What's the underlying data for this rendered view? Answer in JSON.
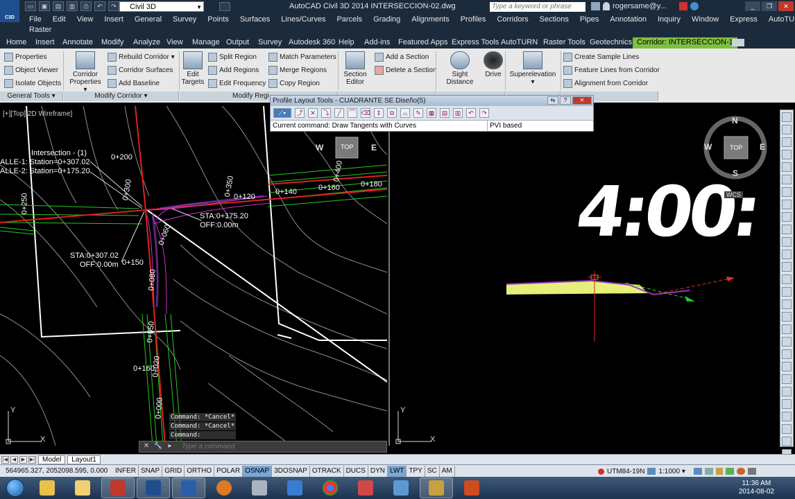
{
  "titlebar": {
    "app_logo": "C3D",
    "workspace": "Civil 3D",
    "title": "AutoCAD Civil 3D 2014    INTERSECCION-02.dwg",
    "search_placeholder": "Type a keyword or phrase",
    "user": "rogersame@y..."
  },
  "menu": {
    "row1": [
      "File",
      "Edit",
      "View",
      "Insert",
      "General",
      "Survey",
      "Points",
      "Surfaces",
      "Lines/Curves",
      "Parcels",
      "Grading",
      "Alignments",
      "Profiles",
      "Corridors",
      "Sections",
      "Pipes",
      "Annotation",
      "Inquiry",
      "Window",
      "Express",
      "AutoTURN"
    ],
    "row2": "Raster"
  },
  "ribbon_tabs": [
    "Home",
    "Insert",
    "Annotate",
    "Modify",
    "Analyze",
    "View",
    "Manage",
    "Output",
    "Survey",
    "Autodesk 360",
    "Help",
    "Add-ins",
    "Featured Apps",
    "Express Tools",
    "AutoTURN",
    "Raster Tools",
    "Geotechnics",
    "Corridor: INTERSECCION-1"
  ],
  "ribbon": {
    "general_tools": {
      "properties": "Properties",
      "object_viewer": "Object Viewer",
      "isolate_objects": "Isolate Objects",
      "panel_label": "General Tools ▾"
    },
    "modify_corridor": {
      "corridor_properties": "Corridor Properties ▾",
      "rebuild_corridor": "Rebuild Corridor ▾",
      "corridor_surfaces": "Corridor Surfaces",
      "add_baseline": "Add Baseline",
      "edit_targets": "Edit Targets",
      "split_region": "Split Region",
      "add_regions": "Add Regions",
      "edit_frequency": "Edit Frequency",
      "match_parameters": "Match Parameters",
      "merge_regions": "Merge Regions",
      "copy_region": "Copy Region",
      "panel_label": "Modify Corridor ▾",
      "panel_label2": "Modify Regi"
    },
    "section": {
      "section_editor": "Section Editor",
      "add_section": "Add a Section",
      "delete_section": "Delete a Section"
    },
    "analyze": {
      "sight_distance": "Sight Distance",
      "drive": "Drive"
    },
    "superelevation": {
      "label": "Superelevation ▾"
    },
    "launch": {
      "create_sample_lines": "Create Sample Lines",
      "feature_lines": "Feature Lines from Corridor",
      "alignment_from_corridor": "Alignment from Corridor"
    }
  },
  "profile_toolbar": {
    "title": "Profile Layout Tools - CUADRANTE SE Diseño(5)",
    "current_command": "Current command: Draw Tangents with Curves",
    "mode": "PVI based"
  },
  "viewport_left": {
    "label": "[+][Top][2D Wireframe]",
    "intersection_title": "Intersection - (1)",
    "station1": "ALLE-1: Station=0+307.02",
    "station2": "ALLE-2: Station=0+175.20",
    "sta1": "STA:0+307.02",
    "off1": "OFF:0.00m",
    "sta2": "STA:0+175.20",
    "off2": "OFF:0.00m",
    "stations": [
      "0+200",
      "0+300",
      "0+250",
      "0+350",
      "0+400",
      "0+140",
      "0+160",
      "0+180",
      "0+120",
      "0+150",
      "0+060",
      "0+080",
      "0+050",
      "0+020",
      "0+160",
      "0+000"
    ],
    "cube_top": "TOP",
    "cube_w": "W",
    "cube_e": "E"
  },
  "viewport_right": {
    "big_text": "4:00:",
    "cube_n": "N",
    "cube_w": "W",
    "cube_e": "E",
    "cube_s": "S",
    "cube_top": "TOP",
    "wcs": "WCS"
  },
  "command_line": {
    "history": [
      "Command: *Cancel*",
      "Command: *Cancel*",
      "Command:"
    ],
    "placeholder": "Type a command"
  },
  "layout_tabs": [
    "Model",
    "Layout1"
  ],
  "statusbar": {
    "coords": "564965.327, 2052098.595, 0.000",
    "toggles": [
      "INFER",
      "SNAP",
      "GRID",
      "ORTHO",
      "POLAR",
      "OSNAP",
      "3DOSNAP",
      "OTRACK",
      "DUCS",
      "DYN",
      "LWT",
      "TPY",
      "SC",
      "AM"
    ],
    "active_toggles": [
      "OSNAP",
      "LWT"
    ],
    "coord_system": "UTM84-19N",
    "scale": "1:1000 ▾"
  },
  "taskbar": {
    "time": "11:36 AM",
    "date": "2014-08-02"
  },
  "colors": {
    "title_bg": "#1c2b3c",
    "ribbon_bg": "#e8e8e8",
    "active_tab": "#7fbf3f",
    "road_red": "#e02020",
    "road_green": "#22cc22",
    "hatch_magenta": "#cc33cc"
  }
}
